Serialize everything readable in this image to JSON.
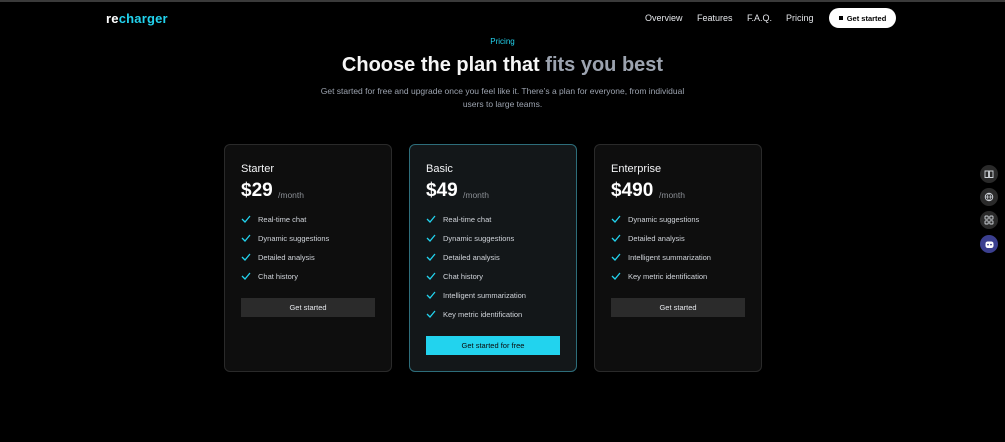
{
  "header": {
    "logo_prefix": "re",
    "logo_suffix": "charger",
    "nav": [
      "Overview",
      "Features",
      "F.A.Q.",
      "Pricing"
    ],
    "cta_label": "Get started"
  },
  "hero": {
    "eyebrow": "Pricing",
    "title_main": "Choose the plan that",
    "title_muted": "fits you best",
    "subtitle": "Get started for free and upgrade once you feel like it. There’s a plan for everyone, from individual users to large teams."
  },
  "plans": [
    {
      "name": "Starter",
      "price": "$29",
      "period": "/month",
      "features": [
        "Real-time chat",
        "Dynamic suggestions",
        "Detailed analysis",
        "Chat history"
      ],
      "button": "Get started"
    },
    {
      "name": "Basic",
      "price": "$49",
      "period": "/month",
      "features": [
        "Real-time chat",
        "Dynamic suggestions",
        "Detailed analysis",
        "Chat history",
        "Intelligent summarization",
        "Key metric identification"
      ],
      "button": "Get started for free"
    },
    {
      "name": "Enterprise",
      "price": "$490",
      "period": "/month",
      "features": [
        "Dynamic suggestions",
        "Detailed analysis",
        "Intelligent summarization",
        "Key metric identification"
      ],
      "button": "Get started"
    }
  ],
  "side_icons": [
    "book-icon",
    "globe-icon",
    "grid-icon",
    "bot-icon"
  ],
  "colors": {
    "accent": "#22d3ee",
    "background": "#000000",
    "card": "#0e0e0e",
    "featured_border": "#2d6d7a"
  }
}
